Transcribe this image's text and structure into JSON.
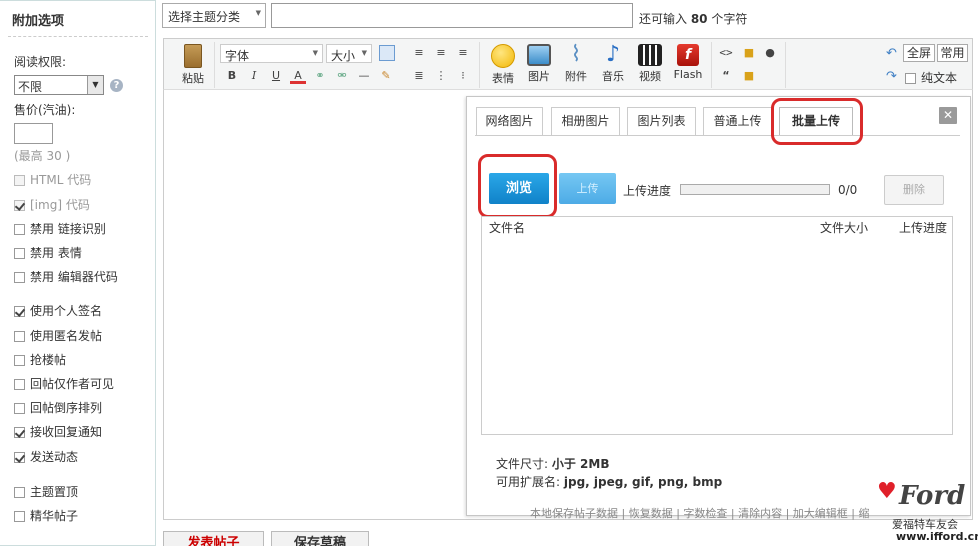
{
  "sidebar": {
    "title": "附加选项",
    "read_perm_label": "阅读权限:",
    "read_perm_value": "不限",
    "price_label": "售价(汽油):",
    "price_value": "",
    "price_max": "(最高 30 )",
    "options": [
      {
        "label": "HTML 代码",
        "checked": false,
        "disabled": true
      },
      {
        "label": "[img] 代码",
        "checked": true,
        "disabled": true
      },
      {
        "label": "禁用 链接识别",
        "checked": false,
        "disabled": false
      },
      {
        "label": "禁用 表情",
        "checked": false,
        "disabled": false
      },
      {
        "label": "禁用 编辑器代码",
        "checked": false,
        "disabled": false
      },
      {
        "label": "使用个人签名",
        "checked": true,
        "disabled": false
      },
      {
        "label": "使用匿名发帖",
        "checked": false,
        "disabled": false
      },
      {
        "label": "抢楼帖",
        "checked": false,
        "disabled": false
      },
      {
        "label": "回帖仅作者可见",
        "checked": false,
        "disabled": false
      },
      {
        "label": "回帖倒序排列",
        "checked": false,
        "disabled": false
      },
      {
        "label": "接收回复通知",
        "checked": true,
        "disabled": false
      },
      {
        "label": "发送动态",
        "checked": true,
        "disabled": false
      },
      {
        "label": "主题置顶",
        "checked": false,
        "disabled": false
      },
      {
        "label": "精华帖子",
        "checked": false,
        "disabled": false
      }
    ]
  },
  "topbar": {
    "category": "选择主题分类",
    "subject_value": "",
    "chars_prefix": "还可输入 ",
    "chars_count": "80",
    "chars_suffix": " 个字符"
  },
  "toolbar": {
    "paste": "粘贴",
    "font": "字体",
    "size": "大小",
    "emoji": "表情",
    "image": "图片",
    "attach": "附件",
    "music": "音乐",
    "video": "视频",
    "flash": "Flash",
    "fullscreen": "全屏",
    "common": "常用",
    "plaintext": "纯文本"
  },
  "dialog": {
    "tabs": [
      "网络图片",
      "相册图片",
      "图片列表",
      "普通上传",
      "批量上传"
    ],
    "active_tab": "批量上传",
    "browse": "浏览",
    "upload": "上传",
    "progress_label": "上传进度",
    "progress_count": "0/0",
    "progress": 0,
    "delete": "删除",
    "col_name": "文件名",
    "col_size": "文件大小",
    "col_progress": "上传进度",
    "size_label": "文件尺寸: ",
    "size_value": "小于 2MB",
    "ext_label": "可用扩展名: ",
    "ext_value": "jpg, jpeg, gif, png, bmp",
    "hint": "本地保存帖子数据 | 恢复数据 | 字数检查 | 清除内容 | 加大编辑框 | 缩小编辑框"
  },
  "buttons": {
    "post": "发表帖子",
    "draft": "保存草稿"
  },
  "logo": {
    "brand": "Ford",
    "sub": "爱福特车友会",
    "site": "www.ifford.cn"
  },
  "colors": {
    "accent": "#1a8fd8",
    "highlight_ring": "#d92b2b"
  }
}
